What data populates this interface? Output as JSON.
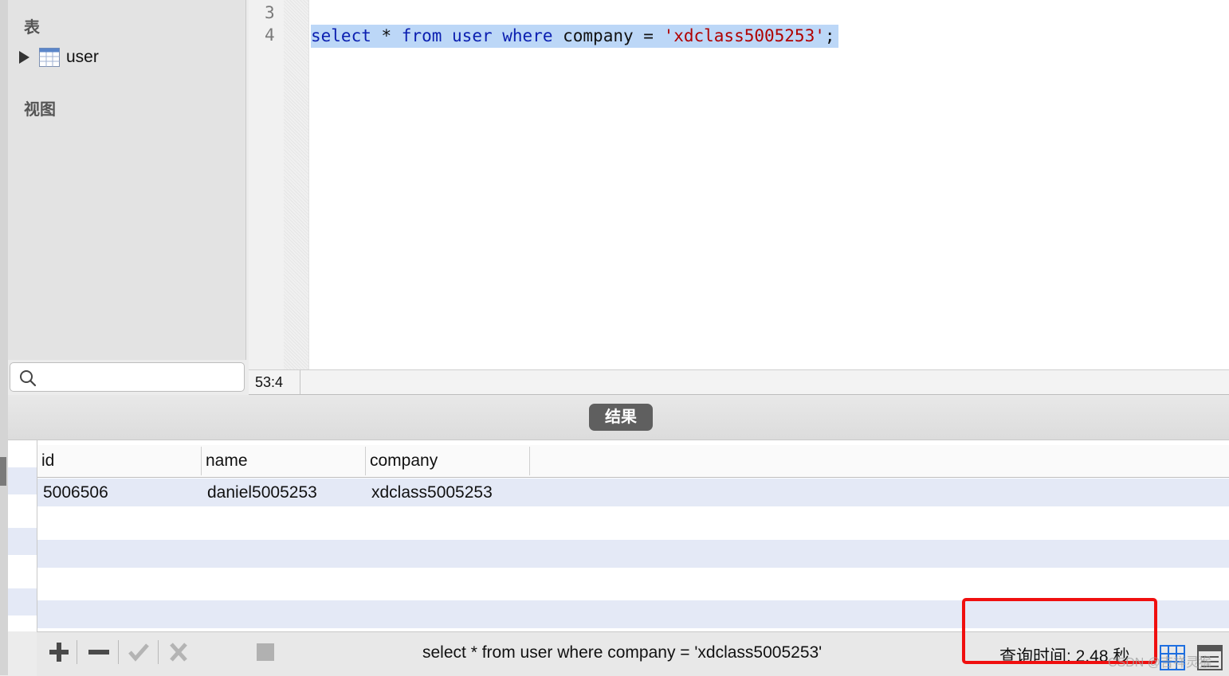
{
  "sidebar": {
    "tables_label": "表",
    "tables": [
      {
        "name": "user"
      }
    ],
    "views_label": "视图",
    "search": {
      "value": "",
      "placeholder": ""
    }
  },
  "editor": {
    "line_numbers": [
      "3",
      "4"
    ],
    "code_tokens": [
      {
        "text": "select",
        "type": "keyword"
      },
      {
        "text": " * ",
        "type": "plain"
      },
      {
        "text": "from",
        "type": "keyword"
      },
      {
        "text": " ",
        "type": "plain"
      },
      {
        "text": "user",
        "type": "keyword"
      },
      {
        "text": " ",
        "type": "plain"
      },
      {
        "text": "where",
        "type": "keyword"
      },
      {
        "text": " company = ",
        "type": "plain"
      },
      {
        "text": "'xdclass5005253'",
        "type": "string"
      },
      {
        "text": ";",
        "type": "plain"
      }
    ],
    "cursor_position": "53:4"
  },
  "results": {
    "tab_label": "结果",
    "columns": [
      "id",
      "name",
      "company"
    ],
    "rows": [
      [
        "5006506",
        "daniel5005253",
        "xdclass5005253"
      ]
    ]
  },
  "status": {
    "query_text": "select * from user where company = 'xdclass5005253'",
    "query_time": "查询时间: 2.48 秒"
  },
  "toolbar": {
    "icons": [
      "add-row-icon",
      "delete-row-icon",
      "apply-changes-icon",
      "discard-changes-icon",
      "stop-icon",
      "grid-view-icon",
      "form-view-icon"
    ]
  },
  "watermark": "CSDN @吉祥灵猴",
  "colors": {
    "keyword": "#0b1fb0",
    "string": "#b00000",
    "selection": "#bcd7f7",
    "row_stripe": "#e4e9f6",
    "highlight_box": "#f00f0f",
    "results_tab": "#5f5f5f"
  }
}
